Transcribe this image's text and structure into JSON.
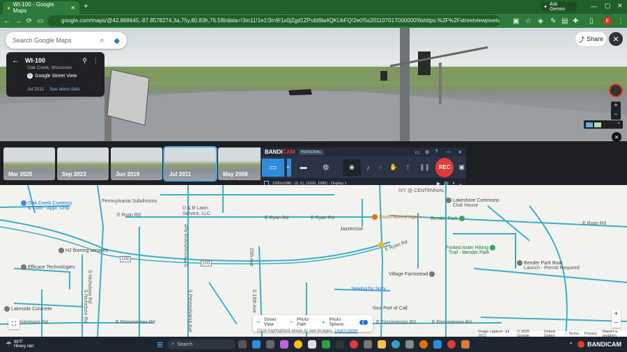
{
  "browser": {
    "tab_title": "WI-100 - Google Maps",
    "new_tab": "+",
    "url": "google.com/maps/@42.868645,-87.8578274,3a,75y,80.83h,76.58t/data=!3m11!1e1!3m9!1s0jZgd1ZPufd9la4QKUkFQ!2e0!5s20110701T000000!6shttps:%2F%2Fstreetviewpixels-pa.googleapis.com%2Fv1%2Ft...",
    "ask_gemini": "Ask Gemini",
    "profile_letter": "E"
  },
  "search": {
    "placeholder": "Search Google Maps"
  },
  "location": {
    "title": "WI-100",
    "subtitle": "Oak Creek, Wisconsin",
    "source": "Google Street View",
    "date": "Jul 2011",
    "latest_link": "See latest date"
  },
  "share_label": "Share",
  "timeline": [
    {
      "label": "Mar 2025"
    },
    {
      "label": "Sep 2023"
    },
    {
      "label": "Jun 2019"
    },
    {
      "label": "Jul 2011"
    },
    {
      "label": "May 2008"
    }
  ],
  "bandicam": {
    "brand_a": "BANDI",
    "brand_b": "CAM",
    "edition": "PERSONAL",
    "rec": "REC",
    "status": "1920x1080 - (0, 0), (1920, 1080) - Display 1"
  },
  "map_labels": {
    "oak_creek_currency": "Oak Creek Currency",
    "oak_creek_currency2": "& Com - Appt. Only",
    "pennsylvania_sub": "Pennsylvania Subdivision",
    "ivy": "IVY @ CENTENNIAL",
    "lakeshore_commons": "Lakeshore Commons",
    "lakeshore_commons2": "Club House",
    "db_lawn": "D & B Lawn",
    "db_lawn2": "Service, LLC",
    "e_ryan_1": "E Ryan Rd",
    "e_ryan_2": "E Ryan Rd",
    "e_ryan_3": "E Ryan Rd",
    "e_ryan_4": "E Ryan Rd",
    "south_bound": "South Bound Again",
    "jazzercise": "Jazzercise",
    "bender_park": "Bender Park",
    "hj_flooring": "HJ flooring services",
    "rd_100": "100",
    "ave_15th": "15th Ave",
    "e_ryan_diag": "E Ryan Rd",
    "forked_aster": "Forked Aster Hiking",
    "forked_aster2": "Trail - Bender Park",
    "efficace": "Efficace Technologies",
    "n_nicholson_1": "S Nicholson Rd",
    "s_pennsylvania": "S Pennsylvania Ave",
    "village_farmstead": "Village Farmstead",
    "bender_park_boat": "Bender Park Boat",
    "bender_park_boat2": "Launch - Permit Required",
    "sewing_suzy": "Sewing by Suzy",
    "lakeside": "Lakeside Concrete",
    "e_fitzsimmons_1": "E Fitzsimmons Rd",
    "e_fitzsimmons_2": "E Fitzsimmons Rd",
    "e_fitzsimmons_3": "E Fitzsimmons Rd",
    "e_fitzsimmons_4": "E Fitzsimmons Rd",
    "port_of_call": "Your Port of Call",
    "n_nicholson_2": "S Nicholson Rd",
    "s_pennsylvania2": "S Pennsylvania Ave",
    "ave_15th_2": "S 15th Ave"
  },
  "legend": {
    "street_view": "Street View",
    "photo_path": "Photo Path",
    "photo_sphere": "Photo Sphere",
    "hint": "Click highlighted areas to see images.",
    "learn_more": "Learn more"
  },
  "attribution": {
    "image_capture": "Image capture: Jul 2011",
    "copyright": "© 2025 Google",
    "country": "United States",
    "terms": "Terms",
    "privacy": "Privacy",
    "report": "Report a problem"
  },
  "taskbar": {
    "weather_temp": "69°F",
    "weather_desc": "Heavy rain",
    "search": "Search",
    "bandicam_tray": "BANDICAM"
  },
  "colors": {
    "chrome_green": "#2d7a3a",
    "road_blue": "#3ab0c8",
    "rec_red": "#e53935",
    "poi_orange": "#e8710a",
    "poi_green": "#34a853"
  }
}
